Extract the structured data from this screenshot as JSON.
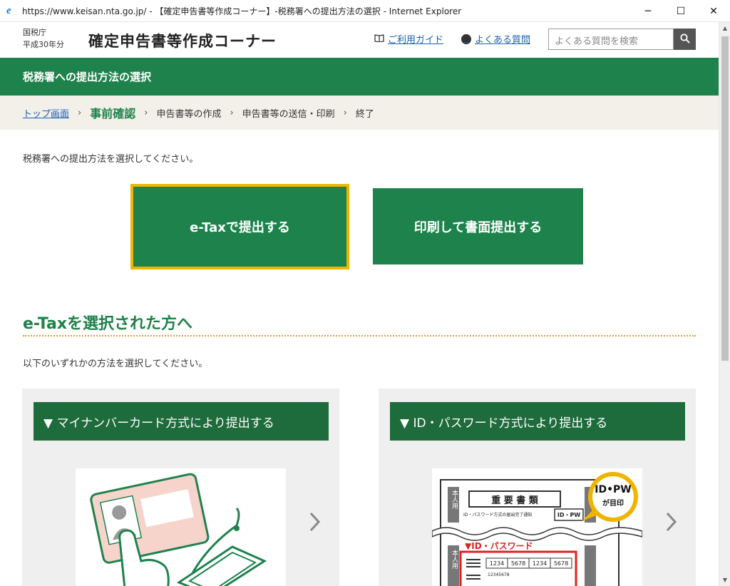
{
  "window": {
    "title": "https://www.keisan.nta.go.jp/ - 【確定申告書等作成コーナー】-税務署への提出方法の選択 - Internet Explorer",
    "minimize": "─",
    "maximize": "☐",
    "close": "✕"
  },
  "header": {
    "agency": "国税庁",
    "year": "平成30年分",
    "site_title": "確定申告書等作成コーナー",
    "guide_link": "ご利用ガイド",
    "faq_link": "よくある質問",
    "search_placeholder": "よくある質問を検索"
  },
  "page": {
    "band_title": "税務署への提出方法の選択",
    "breadcrumb": {
      "top": "トップ画面",
      "step1": "事前確認",
      "step2": "申告書等の作成",
      "step3": "申告書等の送信・印刷",
      "step4": "終了",
      "separator": "›"
    },
    "instruction": "税務署への提出方法を選択してください。",
    "etax_button": "e-Taxで提出する",
    "print_button": "印刷して書面提出する",
    "section_heading": "e-Taxを選択された方へ",
    "sub_instruction": "以下のいずれかの方法を選択してください。"
  },
  "cards": {
    "mynumber": {
      "title": "▼ マイナンバーカード方式により提出する"
    },
    "idpw": {
      "title": "▼ ID・パスワード方式により提出する",
      "doc_title": "重 要 書 類",
      "doc_subtitle": "ID・パスワード方式の届出完了通知",
      "doc_tag": "ID・PW",
      "badge_line1": "ID•PW",
      "badge_line2": "が目印",
      "side_label_1": "本人用",
      "side_label_2": "本人用",
      "pw_heading": "▼ID・パスワード",
      "pw_values": [
        "1234",
        "5678",
        "1234",
        "5678"
      ],
      "pw_id": "12345678"
    }
  },
  "colors": {
    "brand_green": "#1e824c",
    "card_header_green": "#1e6b3c",
    "highlight": "#f0b400",
    "breadcrumb_bg": "#f2f0e8"
  }
}
